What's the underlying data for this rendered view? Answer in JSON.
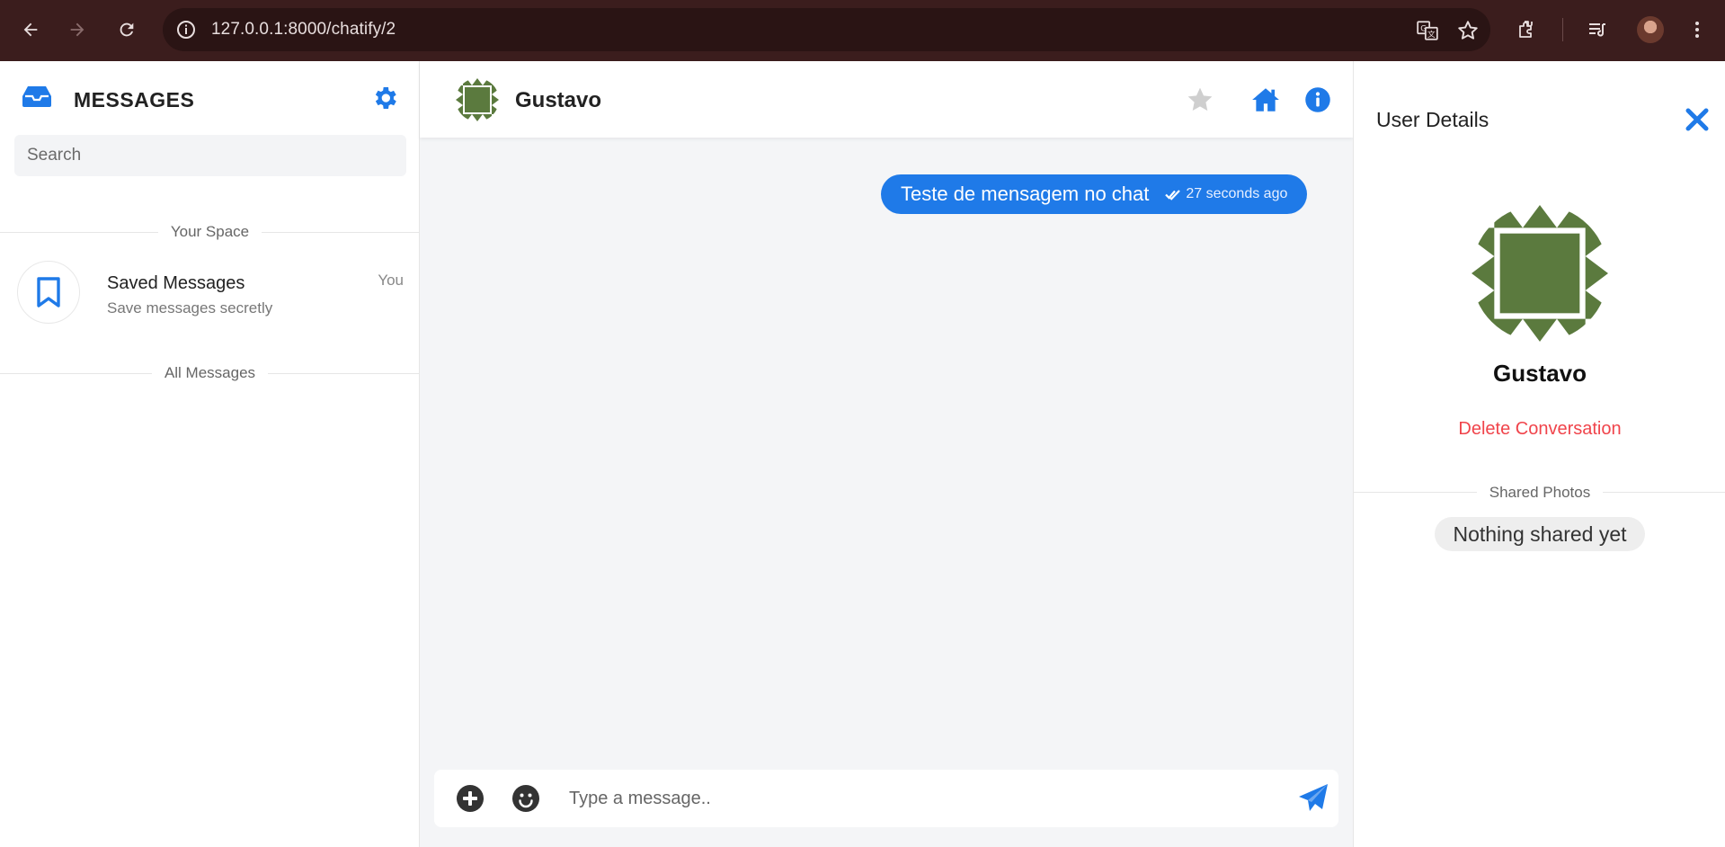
{
  "browser": {
    "url": "127.0.0.1:8000/chatify/2",
    "icons": [
      "back-arrow-icon",
      "forward-arrow-icon",
      "reload-icon",
      "site-info-icon",
      "translate-icon",
      "bookmark-star-icon",
      "extensions-icon",
      "media-controls-icon",
      "profile-avatar",
      "kebab-menu-icon"
    ]
  },
  "sidebar": {
    "title": "MESSAGES",
    "search_placeholder": "Search",
    "your_space_label": "Your Space",
    "saved": {
      "name": "Saved Messages",
      "subtitle": "Save messages secretly",
      "meta": "You"
    },
    "all_messages_label": "All Messages"
  },
  "chat": {
    "contact_name": "Gustavo",
    "messages": [
      {
        "text": "Teste de mensagem no chat",
        "time": "27 seconds ago",
        "status": "read"
      }
    ],
    "input_placeholder": "Type a message.."
  },
  "details": {
    "title": "User Details",
    "name": "Gustavo",
    "delete_label": "Delete Conversation",
    "shared_photos_label": "Shared Photos",
    "empty_label": "Nothing shared yet"
  },
  "colors": {
    "accent": "#1f7ae8",
    "danger": "#f0444b",
    "avatar_green": "#5b7a3e",
    "chrome_bg": "#3b1d1d"
  }
}
